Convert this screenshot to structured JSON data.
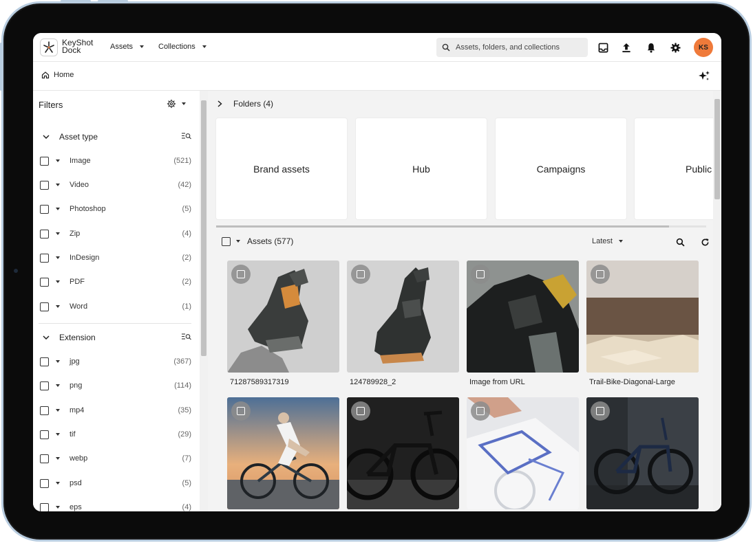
{
  "app": {
    "brand": [
      "KeyShot",
      "Dock"
    ],
    "avatar_initials": "KS",
    "accent_color": "#ef7a3a"
  },
  "topnav": {
    "assets_label": "Assets",
    "collections_label": "Collections",
    "search_placeholder": "Assets, folders, and collections",
    "icons": [
      "inbox-icon",
      "upload-icon",
      "bell-icon",
      "gear-icon"
    ]
  },
  "breadcrumb": {
    "home_label": "Home"
  },
  "filters": {
    "title": "Filters",
    "asset_type": {
      "title": "Asset type",
      "items": [
        {
          "label": "Image",
          "count": "(521)"
        },
        {
          "label": "Video",
          "count": "(42)"
        },
        {
          "label": "Photoshop",
          "count": "(5)"
        },
        {
          "label": "Zip",
          "count": "(4)"
        },
        {
          "label": "InDesign",
          "count": "(2)"
        },
        {
          "label": "PDF",
          "count": "(2)"
        },
        {
          "label": "Word",
          "count": "(1)"
        }
      ]
    },
    "extension": {
      "title": "Extension",
      "items": [
        {
          "label": "jpg",
          "count": "(367)"
        },
        {
          "label": "png",
          "count": "(114)"
        },
        {
          "label": "mp4",
          "count": "(35)"
        },
        {
          "label": "tif",
          "count": "(29)"
        },
        {
          "label": "webp",
          "count": "(7)"
        },
        {
          "label": "psd",
          "count": "(5)"
        },
        {
          "label": "eps",
          "count": "(4)"
        }
      ]
    }
  },
  "folders": {
    "title": "Folders (4)",
    "items": [
      "Brand assets",
      "Hub",
      "Campaigns",
      "Public"
    ]
  },
  "assets": {
    "title": "Assets (577)",
    "sort_label": "Latest",
    "items": [
      {
        "name": "71287589317319"
      },
      {
        "name": "124789928_2"
      },
      {
        "name": "Image from URL"
      },
      {
        "name": "Trail-Bike-Diagonal-Large"
      },
      {
        "name": ""
      },
      {
        "name": ""
      },
      {
        "name": ""
      },
      {
        "name": ""
      }
    ]
  }
}
